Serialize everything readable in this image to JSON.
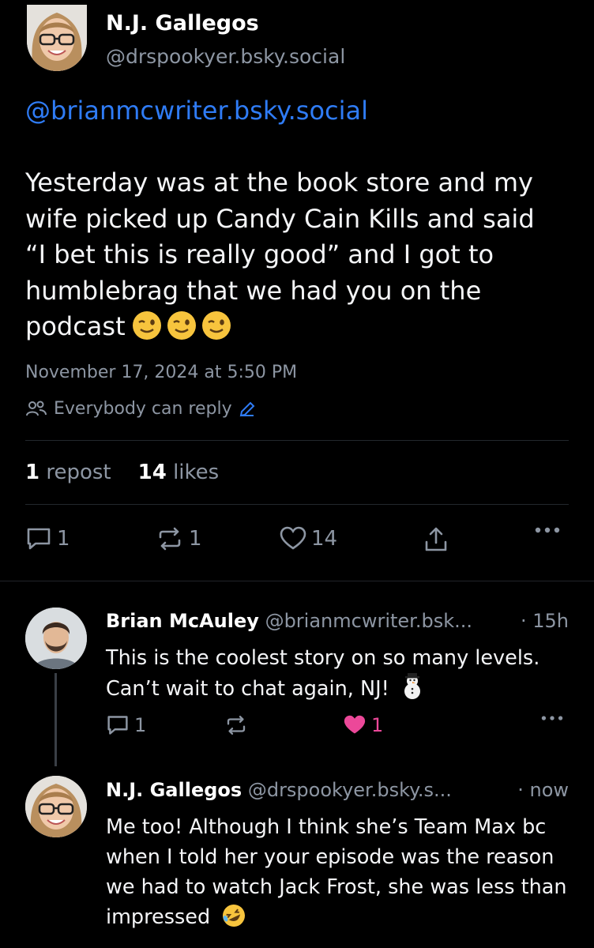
{
  "post": {
    "author_name": "N.J. Gallegos",
    "author_handle": "@drspookyer.bsky.social",
    "mention": "@brianmcwriter.bsky.social",
    "text": "Yesterday was at the book store and my wife picked up Candy Cain Kills and said “I bet this is really good” and I got to humblebrag that we had you on the podcast",
    "timestamp": "November 17, 2024 at 5:50 PM",
    "reply_permission": "Everybody can reply",
    "reposts_count": "1",
    "reposts_label": "repost",
    "likes_count": "14",
    "likes_label": "likes",
    "reply_action_count": "1",
    "repost_action_count": "1",
    "like_action_count": "14"
  },
  "replies": [
    {
      "author_name": "Brian McAuley",
      "author_handle": "@brianmcwriter.bsk...",
      "time": "· 15h",
      "text": "This is the coolest story on so many levels. Can’t wait to chat again, NJ!",
      "reply_count": "1",
      "like_count": "1",
      "liked_color": "#ec4899"
    },
    {
      "author_name": "N.J. Gallegos",
      "author_handle": "@drspookyer.bsky.s...",
      "time": "· now",
      "text": "Me too! Although I think she’s Team Max bc when I told her your episode was the reason we had to watch Jack Frost, she was less than impressed"
    }
  ],
  "colors": {
    "background": "#000000",
    "link": "#2f7cf6",
    "muted": "#8d96a3",
    "like_active": "#ec4899"
  }
}
